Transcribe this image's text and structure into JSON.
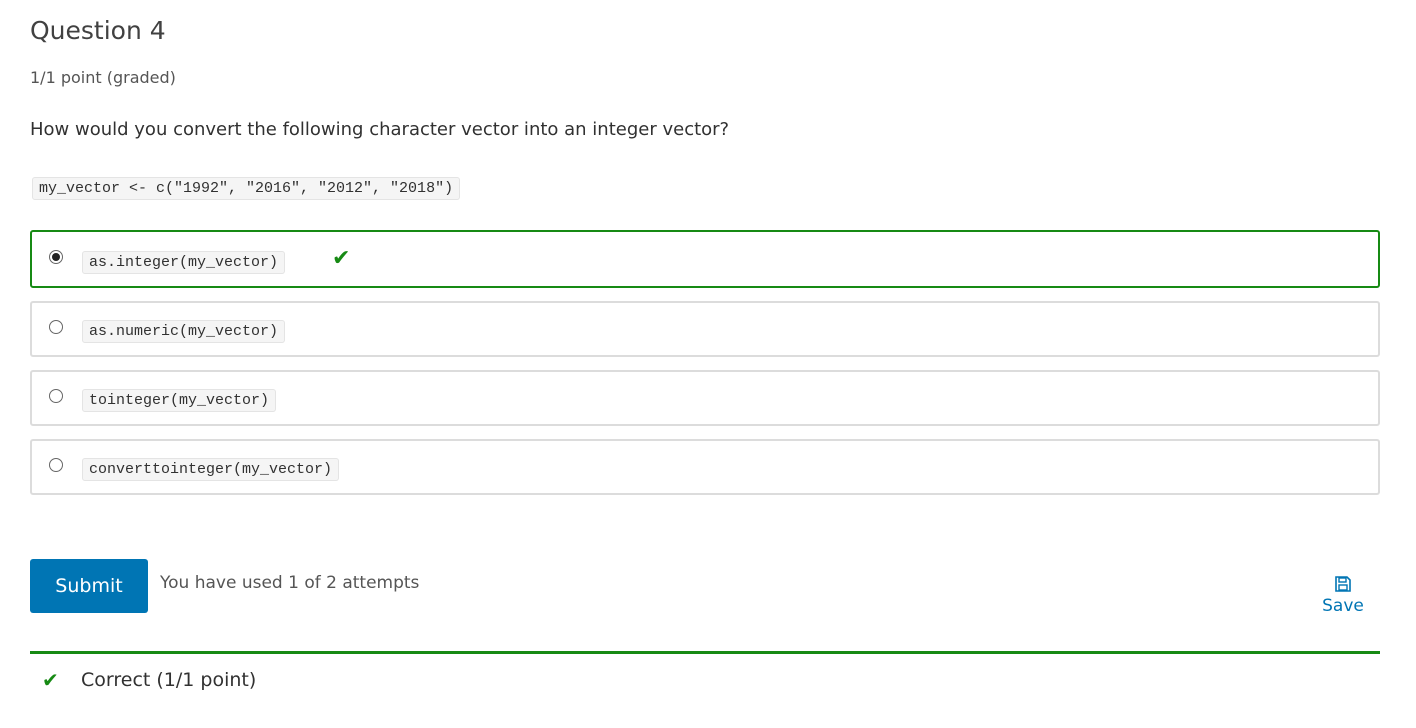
{
  "question": {
    "title": "Question 4",
    "points": "1/1 point (graded)",
    "prompt": "How would you convert the following character vector into an integer vector?",
    "code": "my_vector <- c(\"1992\", \"2016\", \"2012\", \"2018\")"
  },
  "options": [
    {
      "label": "as.integer(my_vector)",
      "selected": true,
      "correct": true
    },
    {
      "label": "as.numeric(my_vector)",
      "selected": false
    },
    {
      "label": "tointeger(my_vector)",
      "selected": false
    },
    {
      "label": "converttointeger(my_vector)",
      "selected": false
    }
  ],
  "actions": {
    "submit_label": "Submit",
    "attempts_text": "You have used 1 of 2 attempts",
    "save_label": "Save",
    "save_icon": "save-icon"
  },
  "feedback": {
    "text": "Correct (1/1 point)",
    "icon": "checkmark-icon",
    "color": "#178a14"
  },
  "colors": {
    "accent": "#0075b4",
    "correct": "#178a14"
  }
}
